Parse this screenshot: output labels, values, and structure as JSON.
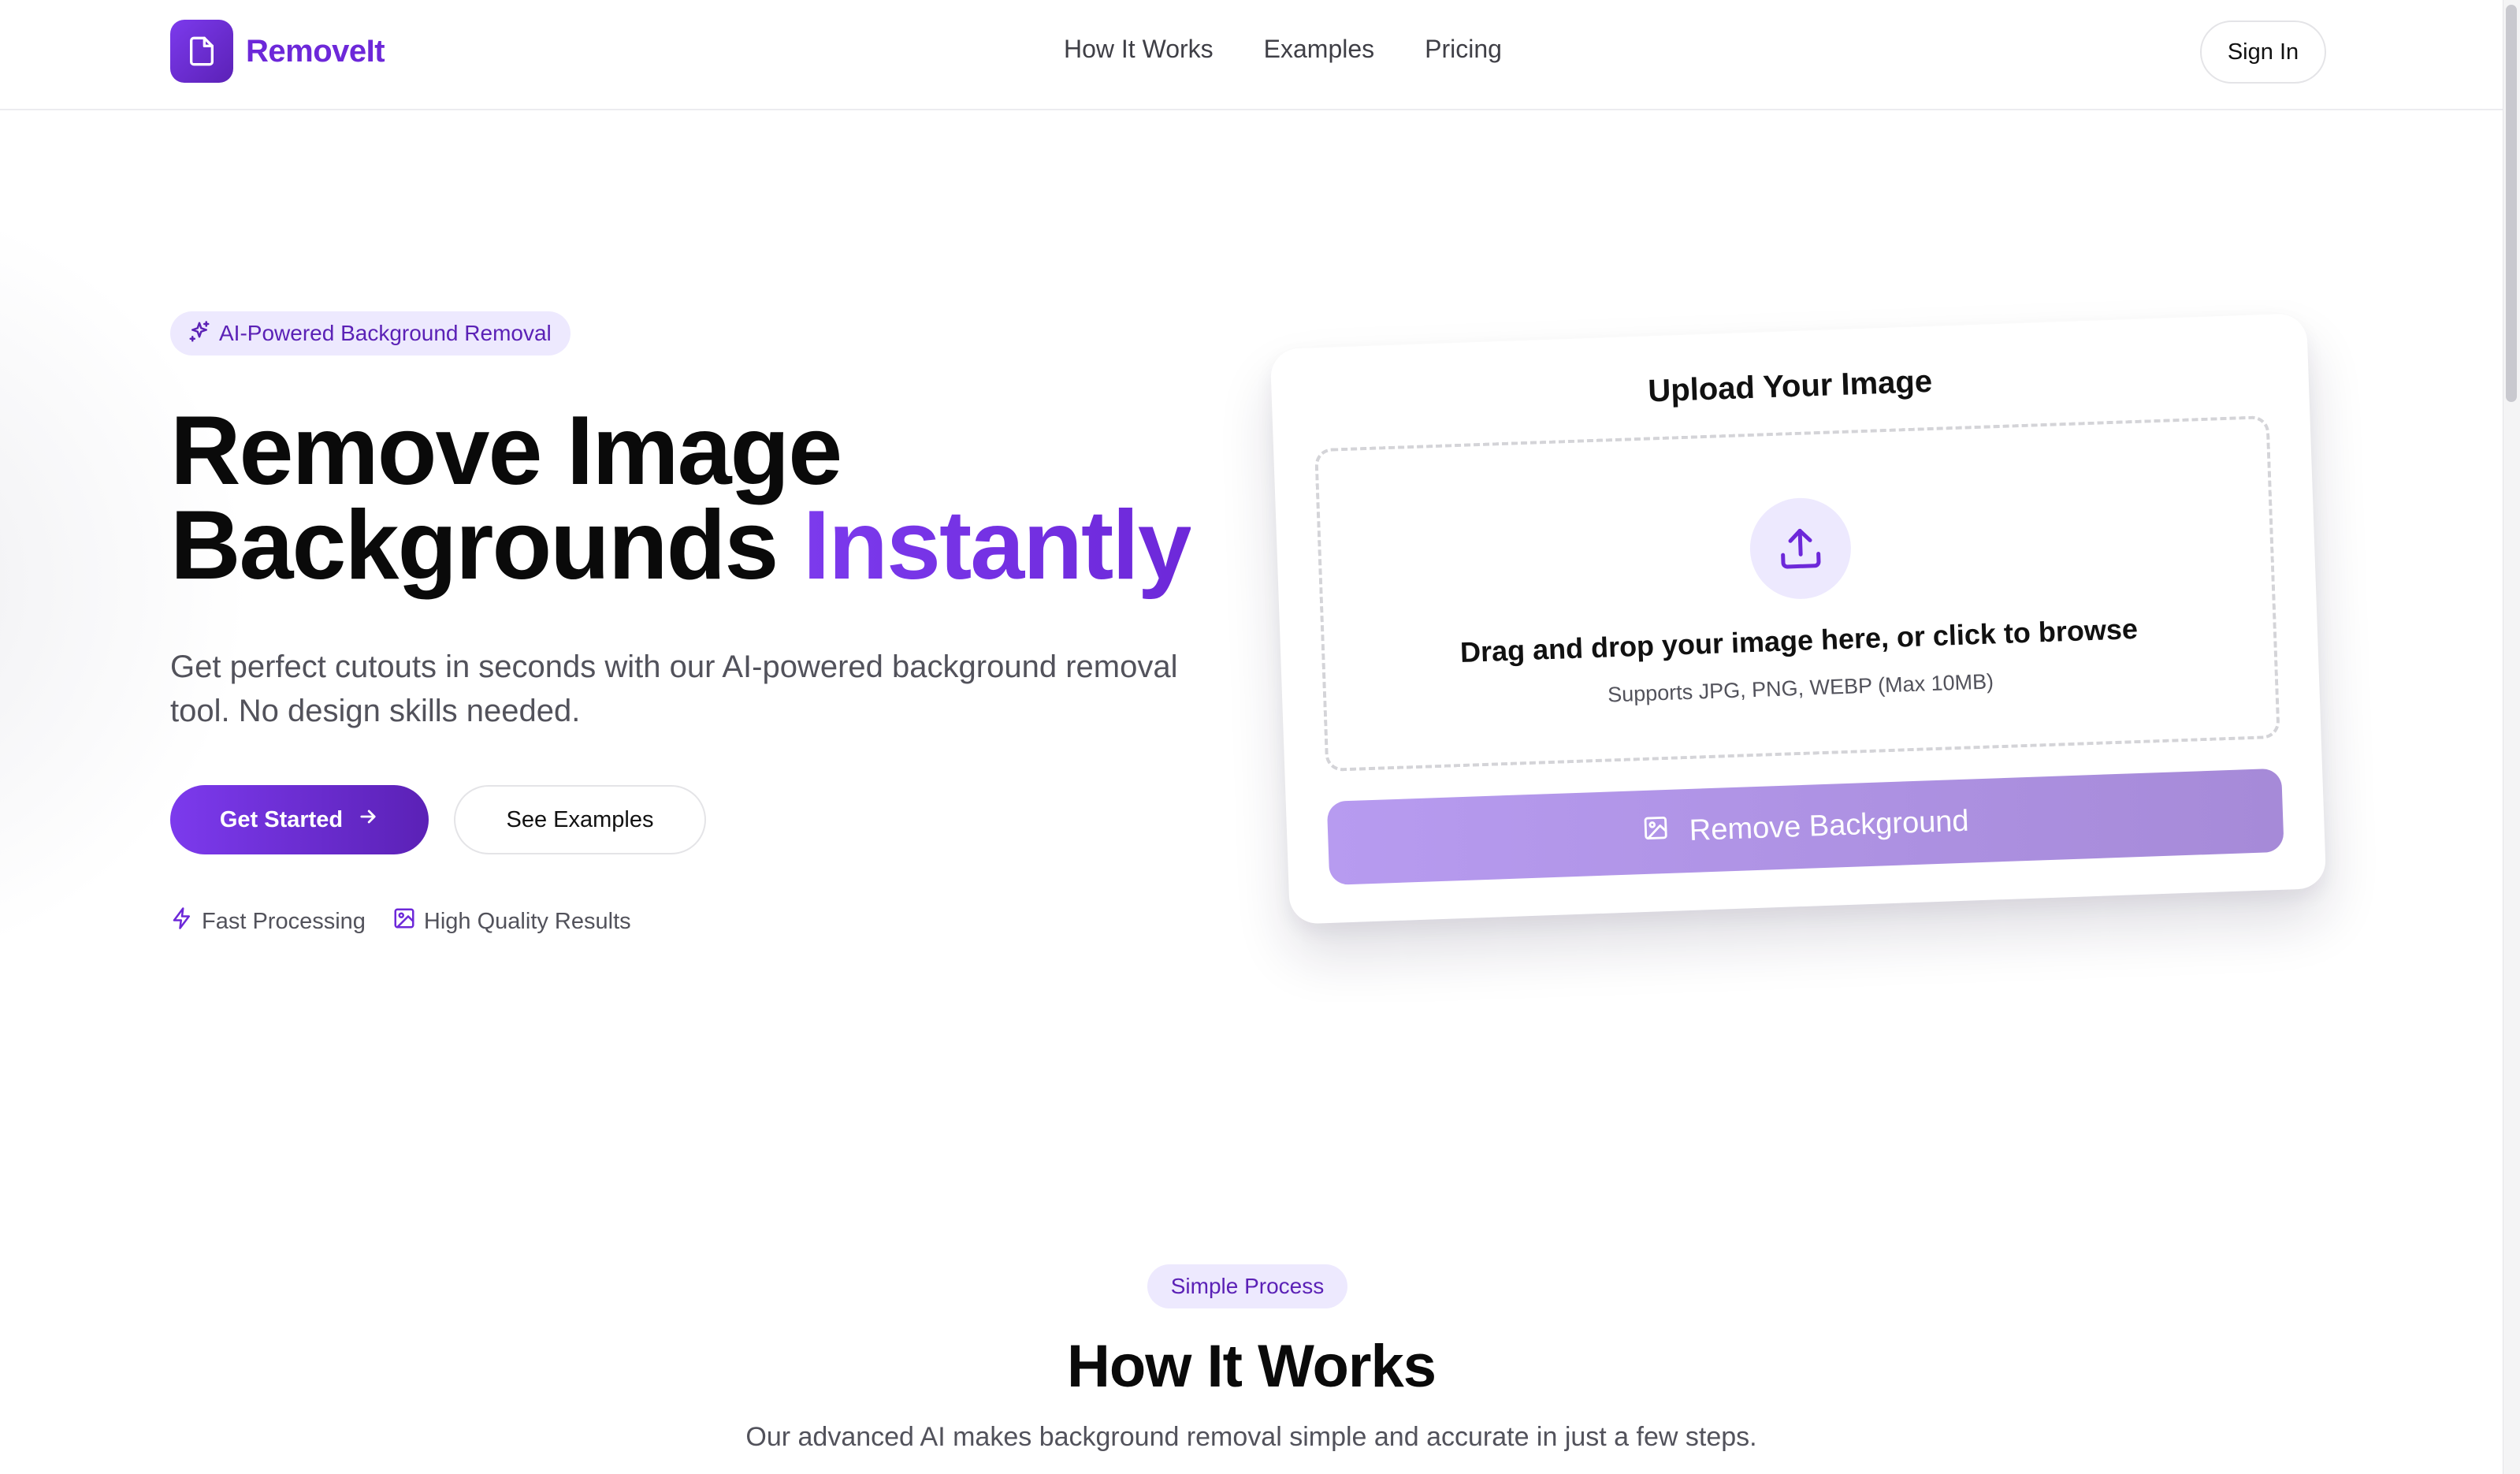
{
  "brand": {
    "name": "RemoveIt",
    "logo_icon": "document-icon",
    "accent_color": "#6d28d9"
  },
  "nav": {
    "items": [
      {
        "label": "How It Works"
      },
      {
        "label": "Examples"
      },
      {
        "label": "Pricing"
      }
    ],
    "sign_in_label": "Sign In"
  },
  "hero": {
    "badge": {
      "icon": "sparkles-icon",
      "label": "AI-Powered Background Removal"
    },
    "title_line1": "Remove Image",
    "title_line2": "Backgrounds",
    "title_accent": "Instantly",
    "subtitle": "Get perfect cutouts in seconds with our AI-powered background removal tool. No design skills needed.",
    "primary_cta": "Get Started",
    "primary_cta_icon": "arrow-right-icon",
    "secondary_cta": "See Examples",
    "features": [
      {
        "icon": "lightning-icon",
        "label": "Fast Processing"
      },
      {
        "icon": "image-icon",
        "label": "High Quality Results"
      }
    ]
  },
  "upload": {
    "title": "Upload Your Image",
    "upload_icon": "upload-icon",
    "drop_text": "Drag and drop your image here, or click to browse",
    "hint": "Supports JPG, PNG, WEBP (Max 10MB)",
    "action_label": "Remove Background",
    "action_icon": "image-icon",
    "action_state": "disabled"
  },
  "how_it_works": {
    "badge": "Simple Process",
    "title": "How It Works",
    "subtitle": "Our advanced AI makes background removal simple and accurate in just a few steps."
  }
}
